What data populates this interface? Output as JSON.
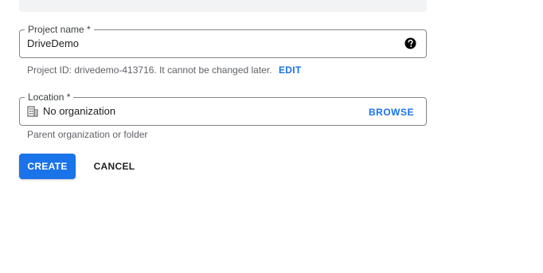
{
  "form": {
    "project_name": {
      "label": "Project name *",
      "value": "DriveDemo",
      "help_icon": "help-circle-icon"
    },
    "project_id": {
      "helper_text": "Project ID: drivedemo-413716. It cannot be changed later.",
      "edit_label": "EDIT"
    },
    "location": {
      "label": "Location *",
      "value": "No organization",
      "icon": "building-icon",
      "browse_label": "BROWSE",
      "helper_text": "Parent organization or folder"
    },
    "actions": {
      "create_label": "CREATE",
      "cancel_label": "CANCEL"
    }
  },
  "colors": {
    "primary": "#1a73e8",
    "border": "#80868b",
    "helper_text": "#5f6368",
    "banner": "#f1f3f4"
  }
}
